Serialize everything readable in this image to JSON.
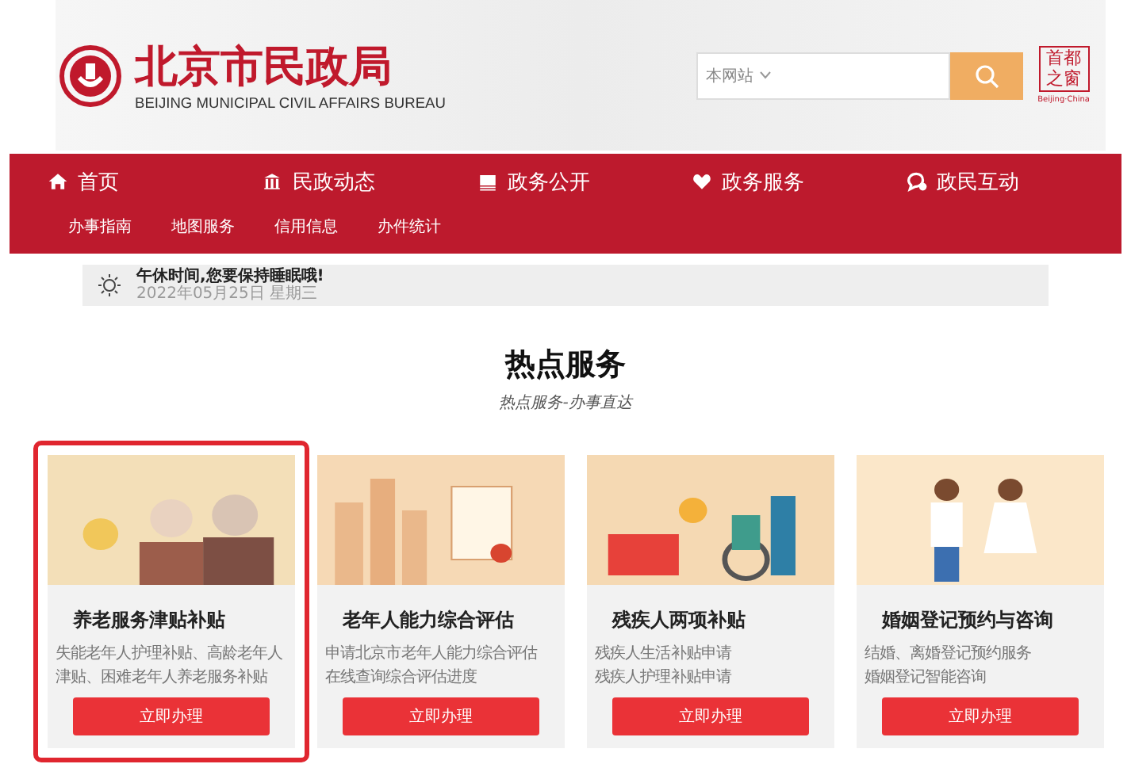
{
  "header": {
    "title": "北京市民政局",
    "subtitle": "BEIJING MUNICIPAL CIVIL AFFAIRS BUREAU",
    "search": {
      "scope": "本网站"
    },
    "seal": {
      "text": "首都之窗",
      "caption": "Beijing·China"
    }
  },
  "nav": {
    "items": [
      {
        "label": "首页"
      },
      {
        "label": "民政动态"
      },
      {
        "label": "政务公开"
      },
      {
        "label": "政务服务"
      },
      {
        "label": "政民互动"
      }
    ],
    "subitems": [
      "办事指南",
      "地图服务",
      "信用信息",
      "办件统计"
    ]
  },
  "notice": {
    "message": "午休时间,您要保持睡眠哦!",
    "date": "2022年05月25日 星期三"
  },
  "section": {
    "title": "热点服务",
    "subtitle": "热点服务-办事直达"
  },
  "cards": [
    {
      "title": "养老服务津贴补贴",
      "lines": [
        "失能老年人护理补贴、高龄老年人",
        "津贴、困难老年人养老服务补贴"
      ],
      "button": "立即办理",
      "highlighted": true
    },
    {
      "title": "老年人能力综合评估",
      "lines": [
        "申请北京市老年人能力综合评估",
        "在线查询综合评估进度"
      ],
      "button": "立即办理",
      "highlighted": false
    },
    {
      "title": "残疾人两项补贴",
      "lines": [
        "残疾人生活补贴申请",
        "残疾人护理补贴申请"
      ],
      "button": "立即办理",
      "highlighted": false
    },
    {
      "title": "婚姻登记预约与咨询",
      "lines": [
        "结婚、离婚登记预约服务",
        "婚姻登记智能咨询"
      ],
      "button": "立即办理",
      "highlighted": false
    }
  ]
}
